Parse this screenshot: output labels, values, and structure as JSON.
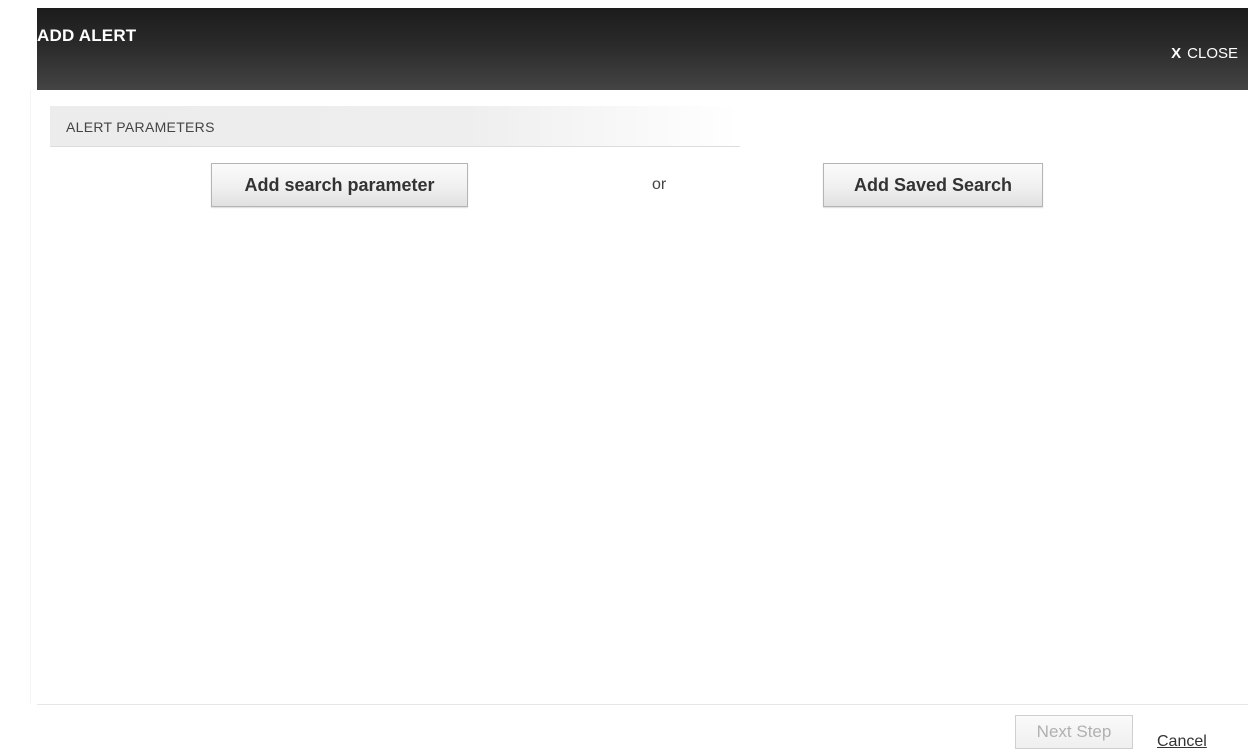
{
  "dialog": {
    "title": "ADD ALERT",
    "close_x": "X",
    "close_label": "CLOSE"
  },
  "section": {
    "title": "ALERT PARAMETERS"
  },
  "actions": {
    "add_search_parameter": "Add search parameter",
    "separator": "or",
    "add_saved_search": "Add Saved Search"
  },
  "footer": {
    "next_step": "Next Step",
    "next_step_enabled": false,
    "cancel": "Cancel"
  },
  "colors": {
    "titlebar": "#2a2a2a",
    "title_text": "#ffffff",
    "section_bg": "#eeeeee",
    "disabled_text": "#b0b0b0"
  }
}
